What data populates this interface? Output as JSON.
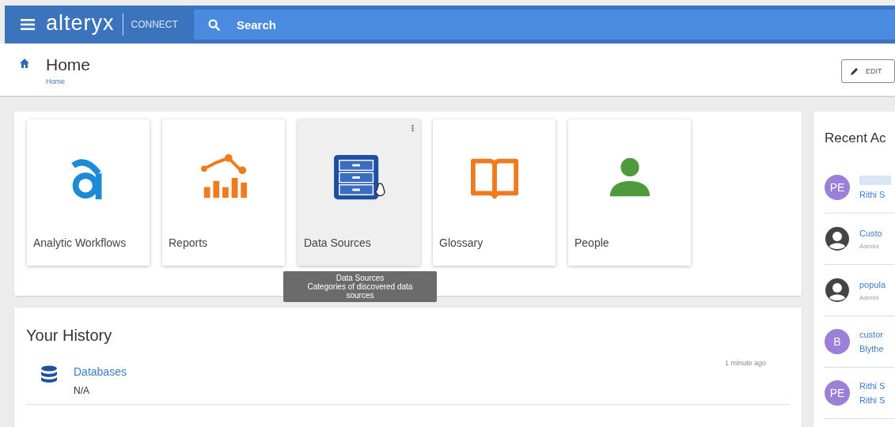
{
  "header": {
    "logo": "alteryx",
    "product": "CONNECT",
    "search": {
      "placeholder": "Search"
    }
  },
  "page": {
    "title": "Home",
    "breadcrumb": "Home",
    "edit_button": "EDIT"
  },
  "tiles": [
    {
      "label": "Analytic Workflows",
      "kind": "workflows",
      "hovered": false
    },
    {
      "label": "Reports",
      "kind": "reports",
      "hovered": false
    },
    {
      "label": "Data Sources",
      "kind": "datasources",
      "hovered": true
    },
    {
      "label": "Glossary",
      "kind": "glossary",
      "hovered": false
    },
    {
      "label": "People",
      "kind": "people",
      "hovered": false
    }
  ],
  "tooltip": {
    "title": "Data Sources",
    "description": "Categories of discovered data sources"
  },
  "history": {
    "title": "Your History",
    "items": [
      {
        "name": "Databases",
        "subtitle": "N/A",
        "time": "1 minute ago"
      }
    ]
  },
  "recent": {
    "title": "Recent Ac",
    "items": [
      {
        "kind": "initials",
        "initials": "PE",
        "color": "#9c7fd6",
        "title_hidden": true,
        "lines": [
          {
            "text": "Rithi S",
            "kind": "link"
          }
        ]
      },
      {
        "kind": "person",
        "title_hidden": false,
        "lines": [
          {
            "text": "Custo",
            "kind": "link"
          },
          {
            "text": "Admini",
            "kind": "meta"
          }
        ]
      },
      {
        "kind": "person",
        "title_hidden": false,
        "lines": [
          {
            "text": "popula",
            "kind": "link"
          },
          {
            "text": "Admini",
            "kind": "meta"
          }
        ]
      },
      {
        "kind": "initials",
        "initials": "B",
        "color": "#9c7fd6",
        "title_hidden": false,
        "lines": [
          {
            "text": "custor",
            "kind": "link"
          },
          {
            "text": "Blythe",
            "kind": "link"
          }
        ]
      },
      {
        "kind": "initials",
        "initials": "PE",
        "color": "#9c7fd6",
        "title_hidden": false,
        "lines": [
          {
            "text": "Rithi S",
            "kind": "link"
          },
          {
            "text": "Rithi S",
            "kind": "link"
          }
        ]
      }
    ]
  }
}
